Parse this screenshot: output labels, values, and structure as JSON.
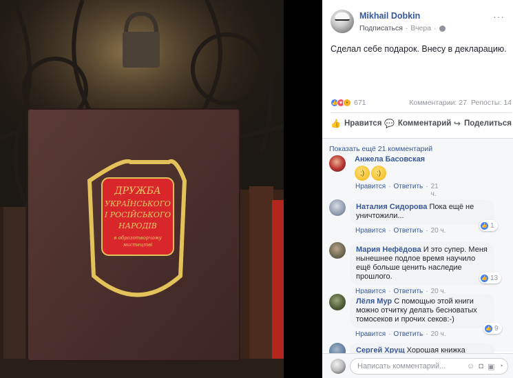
{
  "photo": {
    "book_cover_lines": [
      "ДРУЖБА",
      "УКРАЇНСЬКОГО",
      "І РОСІЙСЬКОГО",
      "НАРОДІВ"
    ],
    "book_cover_subtitle": [
      "в образотворчому",
      "мистецтві"
    ],
    "colors": {
      "cover": "#4a2f2c",
      "emblem": "#d8262a",
      "gold": "#e3c25a"
    }
  },
  "post": {
    "author": "Mikhail Dobkin",
    "follow_label": "Подписаться",
    "time": "Вчера",
    "privacy_icon": "globe-icon",
    "text": "Сделал себе подарок. Внесу в декларацию.",
    "reactions": {
      "icons": [
        "like",
        "love",
        "wow"
      ],
      "count": "671"
    },
    "comments_count": "Комментарии: 27",
    "shares_count": "Репосты: 14",
    "actions": {
      "like": "Нравится",
      "comment": "Комментарий",
      "share": "Поделиться"
    }
  },
  "comments_section": {
    "show_more": "Показать ещё 21 комментарий",
    "like_label": "Нравится",
    "reply_label": "Ответить",
    "items": [
      {
        "name": "Анжела Басовская",
        "text": "",
        "time": "21 ч.",
        "likes": ""
      },
      {
        "name": "Наталия Сидорова",
        "text": "Пока ещё не уничтожили...",
        "time": "20 ч.",
        "likes": "1"
      },
      {
        "name": "Мария Нефёдова",
        "text": "И это супер. Меня нынешнее подлое время научило ещё больше ценить наследие прошлого.",
        "time": "20 ч.",
        "likes": "13"
      },
      {
        "name": "Лёля Мур",
        "text": "С помощью этой книги можно отчитку делать бесноватых томосеков и прочих секов:-)",
        "time": "20 ч.",
        "likes": "9"
      },
      {
        "name": "Сергей Хрущ",
        "text": "Хорошая книжка",
        "time": "",
        "likes": ""
      }
    ]
  },
  "composer": {
    "placeholder": "Написать комментарий..."
  }
}
